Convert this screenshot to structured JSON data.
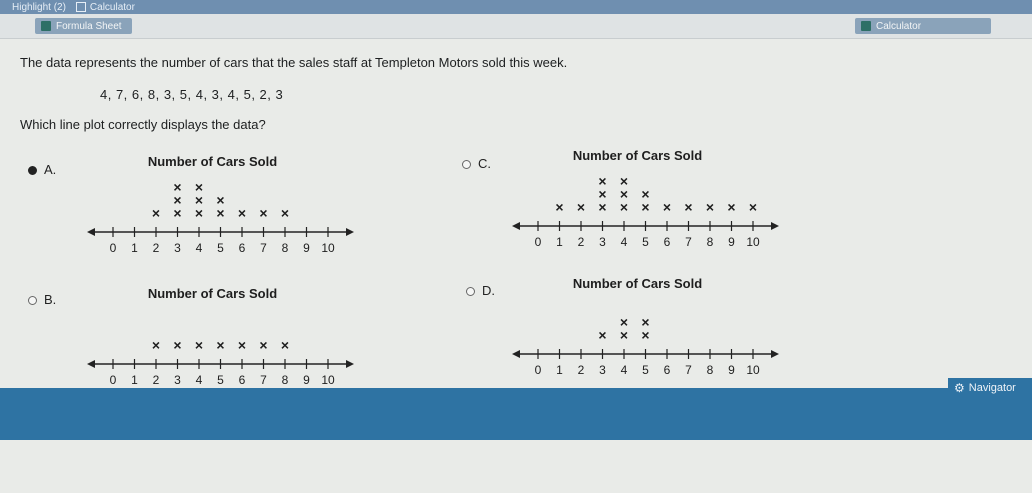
{
  "topbar": {
    "highlight": "Highlight (2)",
    "calculator": "Calculator"
  },
  "toolbar": {
    "formula_sheet": "Formula Sheet",
    "calculator": "Calculator"
  },
  "question": {
    "prompt": "The data represents the number of cars that the sales staff at Templeton Motors sold this week.",
    "data_list": "4, 7, 6, 8, 3, 5, 4, 3, 4, 5, 2, 3",
    "ask": "Which line plot correctly displays the data?"
  },
  "options": [
    {
      "letter": "A.",
      "selected": true
    },
    {
      "letter": "B.",
      "selected": false
    },
    {
      "letter": "C.",
      "selected": false
    },
    {
      "letter": "D.",
      "selected": false
    }
  ],
  "chart_data": [
    {
      "type": "scatter",
      "option": "A",
      "title": "Number of Cars Sold",
      "ticks": [
        "0",
        "1",
        "2",
        "3",
        "4",
        "5",
        "6",
        "7",
        "8",
        "9",
        "10"
      ],
      "xlim": [
        0,
        10
      ],
      "counts": [
        0,
        0,
        1,
        3,
        3,
        2,
        1,
        1,
        1,
        0,
        0
      ]
    },
    {
      "type": "scatter",
      "option": "B",
      "title": "Number of Cars Sold",
      "ticks": [
        "0",
        "1",
        "2",
        "3",
        "4",
        "5",
        "6",
        "7",
        "8",
        "9",
        "10"
      ],
      "xlim": [
        0,
        10
      ],
      "counts": [
        0,
        0,
        1,
        1,
        1,
        1,
        1,
        1,
        1,
        0,
        0
      ]
    },
    {
      "type": "scatter",
      "option": "C",
      "title": "Number of Cars Sold",
      "ticks": [
        "0",
        "1",
        "2",
        "3",
        "4",
        "5",
        "6",
        "7",
        "8",
        "9",
        "10"
      ],
      "xlim": [
        0,
        10
      ],
      "counts": [
        0,
        1,
        1,
        3,
        3,
        2,
        1,
        1,
        1,
        1,
        1
      ]
    },
    {
      "type": "scatter",
      "option": "D",
      "title": "Number of Cars Sold",
      "ticks": [
        "0",
        "1",
        "2",
        "3",
        "4",
        "5",
        "6",
        "7",
        "8",
        "9",
        "10"
      ],
      "xlim": [
        0,
        10
      ],
      "counts": [
        0,
        0,
        0,
        1,
        2,
        2,
        0,
        0,
        0,
        0,
        0
      ]
    }
  ],
  "navigator": {
    "label": "Navigator",
    "icon": "gear-icon"
  }
}
